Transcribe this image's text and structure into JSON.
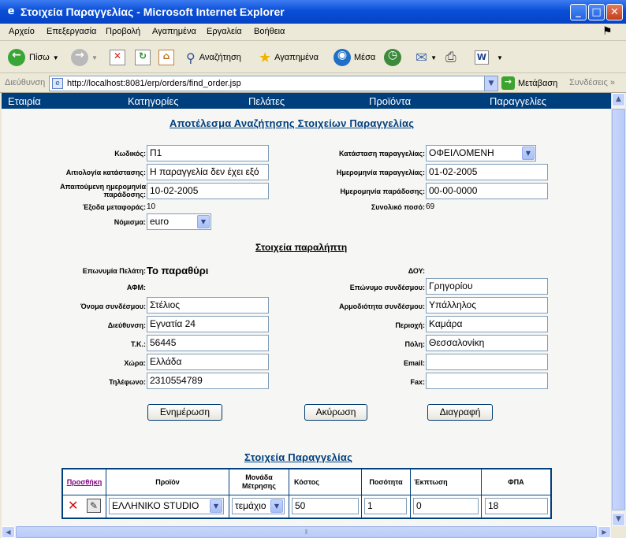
{
  "window": {
    "title": "Στοιχεία Παραγγελίας - Microsoft Internet Explorer",
    "minimize": "_",
    "maximize": "□",
    "close": "✕"
  },
  "menu": [
    "Αρχείο",
    "Επεξεργασία",
    "Προβολή",
    "Αγαπημένα",
    "Εργαλεία",
    "Βοήθεια"
  ],
  "toolbar": {
    "back": "Πίσω",
    "search": "Αναζήτηση",
    "favorites": "Αγαπημένα",
    "media": "Μέσα"
  },
  "address": {
    "label": "Διεύθυνση",
    "url": "http://localhost:8081/erp/orders/find_order.jsp",
    "go": "Μετάβαση",
    "links": "Συνδέσεις"
  },
  "nav": [
    "Εταιρία",
    "Κατηγορίες",
    "Πελάτες",
    "Προϊόντα",
    "Παραγγελίες"
  ],
  "page_title": "Αποτέλεσμα Αναζήτησης Στοιχείων Παραγγελίας",
  "order": {
    "code_label": "Κωδικός:",
    "code": "Π1",
    "status_label": "Κατάσταση παραγγελίας:",
    "status": "ΟΦΕΙΛΟΜΕΝΗ",
    "reason_label": "Αιτιολογία κατάστασης:",
    "reason": "Η παραγγελία δεν έχει εξό",
    "order_date_label": "Ημερομηνία παραγγελίας:",
    "order_date": "01-02-2005",
    "req_date_label_1": "Απαιτούμενη ημερομηνία",
    "req_date_label_2": "παράδοσης:",
    "req_date": "10-02-2005",
    "delivery_date_label": "Ημερομηνία παράδοσης:",
    "delivery_date": "00-00-0000",
    "shipping_label": "Έξοδα μεταφοράς:",
    "shipping": "10",
    "total_label": "Συνολικό ποσό:",
    "total": "69",
    "currency_label": "Νόμισμα:",
    "currency": "euro"
  },
  "recipient": {
    "heading": "Στοιχεία παραλήπτη",
    "name_label": "Επωνυμία Πελάτη:",
    "name": "Το παραθύρι",
    "doy_label": "ΔΟΥ:",
    "afm_label": "ΑΦΜ:",
    "contact_surname_label": "Επώνυμο συνδέσμου:",
    "contact_surname": "Γρηγορίου",
    "contact_name_label": "Όνομα συνδέσμου:",
    "contact_name": "Στέλιος",
    "role_label": "Αρμοδιότητα συνδέσμου:",
    "role": "Υπάλληλος",
    "address_label": "Διεύθυνση:",
    "address": "Εγνατία 24",
    "area_label": "Περιοχή:",
    "area": "Καμάρα",
    "zip_label": "Τ.Κ.:",
    "zip": "56445",
    "city_label": "Πόλη:",
    "city": "Θεσσαλονίκη",
    "country_label": "Χώρα:",
    "country": "Ελλάδα",
    "email_label": "Email:",
    "email": "",
    "phone_label": "Τηλέφωνο:",
    "phone": "2310554789",
    "fax_label": "Fax:",
    "fax": ""
  },
  "buttons": {
    "update": "Ενημέρωση",
    "cancel": "Ακύρωση",
    "delete": "Διαγραφή"
  },
  "items": {
    "heading": "Στοιχεία Παραγγελίας",
    "add_link": "Προσθήκη",
    "col_product": "Προϊόν",
    "col_unit_1": "Μονάδα",
    "col_unit_2": "Μέτρησης",
    "col_cost": "Κόστος",
    "col_qty": "Ποσότητα",
    "col_discount": "Έκπτωση",
    "col_vat": "ΦΠΑ",
    "row": {
      "product": "ΕΛΛΗΝΙΚΟ STUDIO",
      "unit": "τεμάχιο",
      "cost": "50",
      "qty": "1",
      "discount": "0",
      "vat": "18"
    }
  }
}
